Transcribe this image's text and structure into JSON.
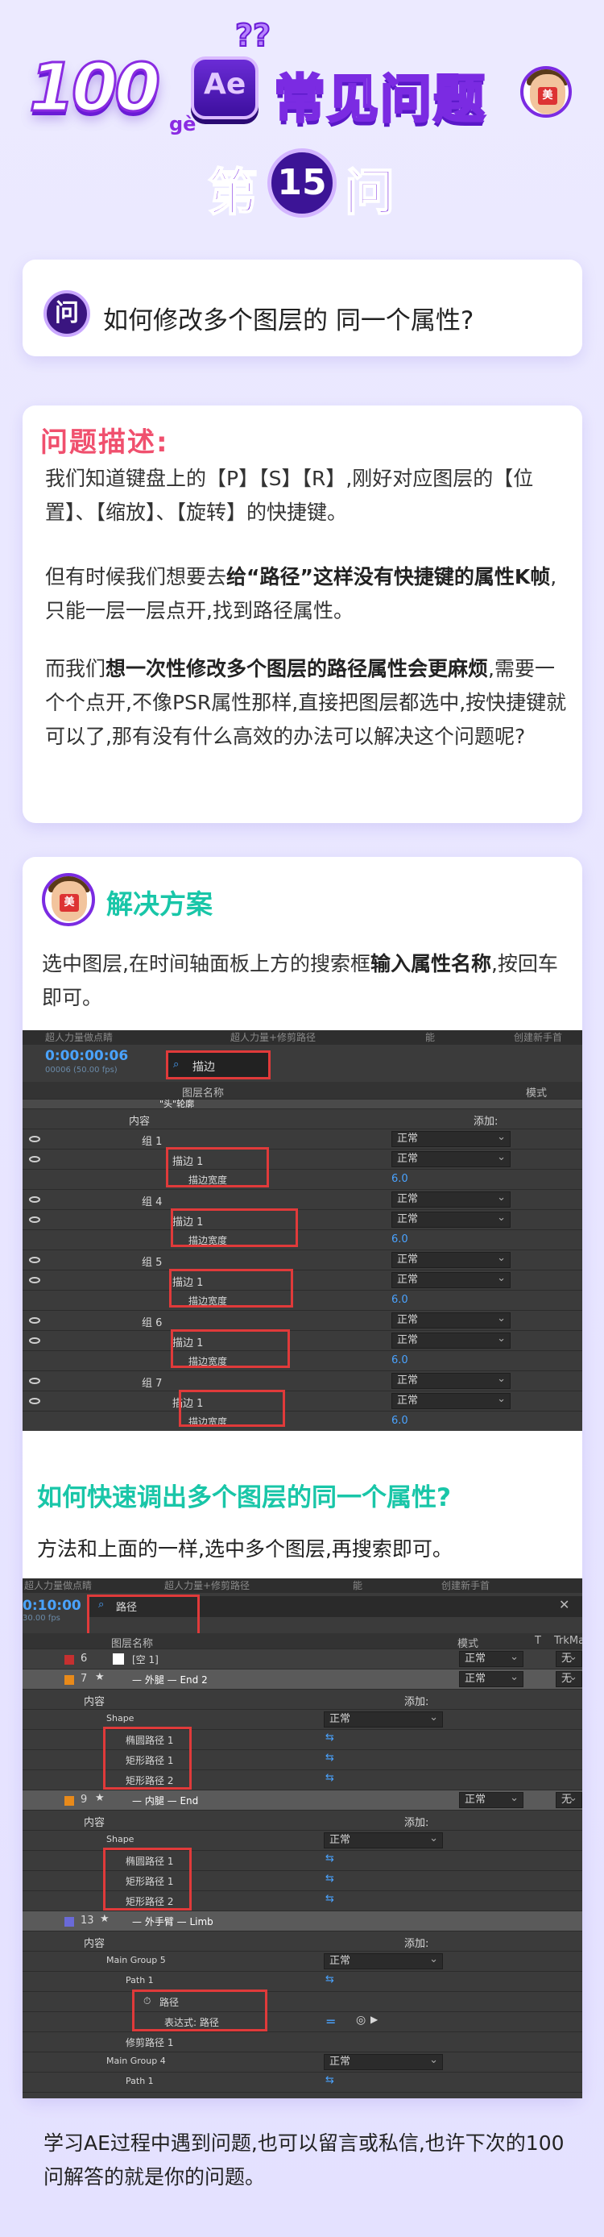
{
  "header": {
    "big_number": "100",
    "ge": "gè",
    "ae_badge": "Ae",
    "title": "常见问题",
    "issue_prefix": "第",
    "issue_number": "15",
    "issue_suffix": "问",
    "avatar_badge": "美"
  },
  "question": {
    "icon": "问",
    "text": "如何修改多个图层的 同一个属性?"
  },
  "description": {
    "title": "问题描述:",
    "p1": "我们知道键盘上的【P】【S】【R】,刚好对应图层的【位置】、【缩放】、【旋转】的快捷键。",
    "p2_pre": "但有时候我们想要去",
    "p2_bold": "给“路径”这样没有快捷键的属性K帧",
    "p2_post": ",只能一层一层点开,找到路径属性。",
    "p3_pre": "而我们",
    "p3_bold": "想一次性修改多个图层的路径属性会更麻烦",
    "p3_post": ",需要一个个点开,不像PSR属性那样,直接把图层都选中,按快捷键就可以了,那有没有什么高效的办法可以解决这个问题呢?"
  },
  "solution": {
    "title": "解决方案",
    "text_pre": "选中图层,在时间轴面板上方的搜索框",
    "text_bold": "输入属性名称",
    "text_post": ",按回车即可。"
  },
  "panel1": {
    "tabs": [
      "超人力量做点睛",
      "超人力量+修剪路径",
      "能",
      "创建新手首"
    ],
    "timecode": "0:00:00:06",
    "subtime": "00006 (50.00 fps)",
    "search": "描边",
    "col_name": "图层名称",
    "col_mode": "模式",
    "col_mode_val": "正常",
    "layer_label": "\"头\"轮廓",
    "content": "内容",
    "add": "添加:",
    "rows": [
      {
        "group": "组 1",
        "stroke": "描边 1",
        "width_label": "描边宽度",
        "mode": "正常",
        "value": "6.0"
      },
      {
        "group": "组 4",
        "stroke": "描边 1",
        "width_label": "描边宽度",
        "mode": "正常",
        "value": "6.0"
      },
      {
        "group": "组 5",
        "stroke": "描边 1",
        "width_label": "描边宽度",
        "mode": "正常",
        "value": "6.0"
      },
      {
        "group": "组 6",
        "stroke": "描边 1",
        "width_label": "描边宽度",
        "mode": "正常",
        "value": "6.0"
      },
      {
        "group": "组 7",
        "stroke": "描边 1",
        "width_label": "描边宽度",
        "mode": "正常",
        "value": "6.0"
      }
    ]
  },
  "quick": {
    "title": "如何快速调出多个图层的同一个属性?",
    "text": "方法和上面的一样,选中多个图层,再搜索即可。"
  },
  "panel2": {
    "tabs": [
      "超人力量做点睛",
      "超人力量+修剪路径",
      "能",
      "创建新手首"
    ],
    "timecode": "0:10:00",
    "subtime": "30.00 fps",
    "search": "路径",
    "col_name": "图层名称",
    "col_mode": "模式",
    "col_t": "T",
    "col_trk": "TrkMa",
    "content": "内容",
    "add": "添加:",
    "mode_val": "正常",
    "none": "无",
    "layer6": {
      "num": "6",
      "name": "[空 1]"
    },
    "layer7": {
      "num": "7",
      "name": "— 外腿 — End 2"
    },
    "layer7_shape": "Shape",
    "layer7_paths": [
      "椭圆路径 1",
      "矩形路径 1",
      "矩形路径 2"
    ],
    "layer9": {
      "num": "9",
      "name": "— 内腿 — End"
    },
    "layer9_shape": "Shape",
    "layer9_paths": [
      "椭圆路径 1",
      "矩形路径 1",
      "矩形路径 2"
    ],
    "layer13": {
      "num": "13",
      "name": "— 外手臂 — Limb"
    },
    "main_group5": "Main Group 5",
    "path1": "Path 1",
    "path_prop": "路径",
    "expression": "表达式: 路径",
    "trim": "修剪路径 1",
    "main_group4": "Main Group 4",
    "path1b": "Path 1"
  },
  "footer": {
    "text": "学习AE过程中遇到问题,也可以留言或私信,也许下次的100问解答的就是你的问题。"
  },
  "colors": {
    "purple": "#7b2be2",
    "teal": "#19c6a8",
    "pink": "#f0506e",
    "red_box": "#e03a3a",
    "ae_bg": "#3b3b3b"
  }
}
